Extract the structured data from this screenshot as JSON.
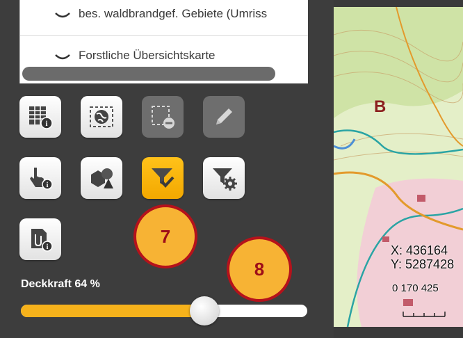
{
  "layers": [
    {
      "label": "bes. waldbrandgef. Gebiete (Umriss"
    },
    {
      "label": "Forstliche Übersichtskarte"
    }
  ],
  "tools": [
    {
      "name": "table-info-icon",
      "state": "normal"
    },
    {
      "name": "globe-zoom-icon",
      "state": "normal"
    },
    {
      "name": "remove-selection-icon",
      "state": "disabled"
    },
    {
      "name": "pencil-icon",
      "state": "disabled"
    },
    {
      "name": "pointer-info-icon",
      "state": "normal"
    },
    {
      "name": "shapes-icon",
      "state": "normal"
    },
    {
      "name": "filter-check-icon",
      "state": "active"
    },
    {
      "name": "filter-settings-icon",
      "state": "normal"
    },
    {
      "name": "document-info-icon",
      "state": "normal"
    }
  ],
  "badges": {
    "seven": "7",
    "eight": "8"
  },
  "opacity": {
    "label": "Deckkraft 64 %",
    "value": 0.64
  },
  "map": {
    "label_b": "B",
    "coord_x": "X: 436164",
    "coord_y": "Y: 5287428",
    "scale_text": "0 170 425"
  },
  "colors": {
    "accent": "#f6b21b",
    "badge_border": "#b5121b",
    "panel": "#3d3d3d"
  }
}
